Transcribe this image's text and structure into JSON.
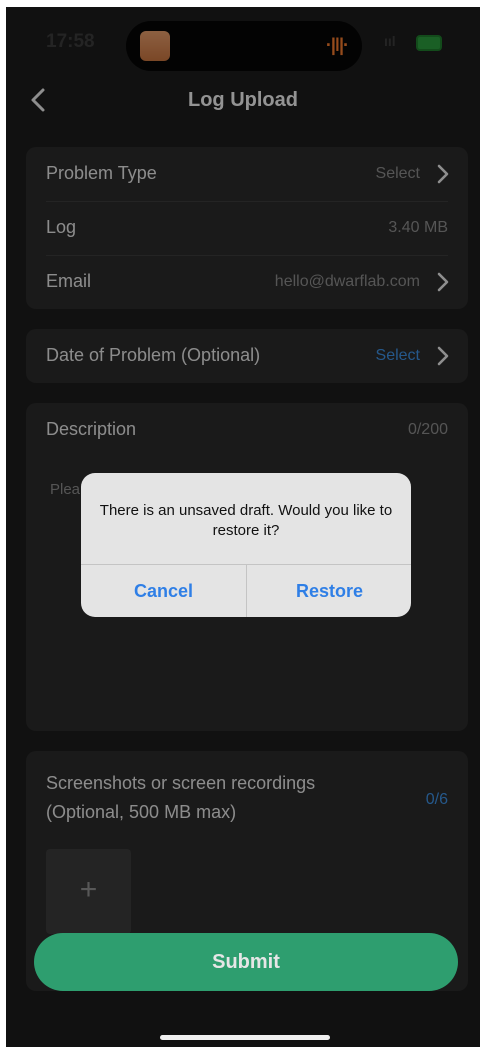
{
  "status_bar": {
    "time": "17:58",
    "signal": "ııl"
  },
  "header": {
    "title": "Log Upload"
  },
  "details": {
    "problem_type": {
      "label": "Problem Type",
      "value": "Select"
    },
    "log": {
      "label": "Log",
      "value": "3.40 MB"
    },
    "email": {
      "label": "Email",
      "value": "hello@dwarflab.com"
    }
  },
  "date": {
    "label": "Date of Problem (Optional)",
    "value": "Select"
  },
  "description": {
    "label": "Description",
    "counter": "0/200",
    "placeholder": "Plea"
  },
  "screenshots": {
    "label": "Screenshots or screen recordings (Optional, 500 MB max)",
    "counter": "0/6",
    "add": "+"
  },
  "submit_label": "Submit",
  "dialog": {
    "message": "There is an unsaved draft. Would you like to restore it?",
    "cancel": "Cancel",
    "restore": "Restore"
  },
  "colors": {
    "accent_green": "#2e9e6f",
    "link_blue": "#3d8fe0",
    "dialog_blue": "#2f7fe6"
  }
}
